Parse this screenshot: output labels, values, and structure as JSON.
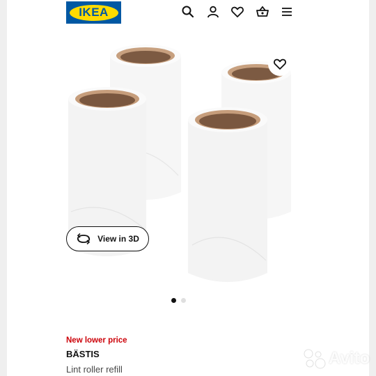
{
  "brand": {
    "logo_text": "IKEA",
    "colors": {
      "blue": "#0058a3",
      "yellow": "#ffdb00"
    }
  },
  "header": {
    "icons": [
      "search-icon",
      "account-icon",
      "favourites-icon",
      "basket-icon",
      "menu-icon"
    ]
  },
  "gallery": {
    "view_3d_label": "View in 3D",
    "dots": {
      "count": 2,
      "active": 1
    }
  },
  "product": {
    "price_tag": "New lower price",
    "name": "BÄSTIS",
    "description": "Lint roller refill",
    "price_tag_color": "#cc0008"
  },
  "watermark": {
    "text": "Avito"
  }
}
